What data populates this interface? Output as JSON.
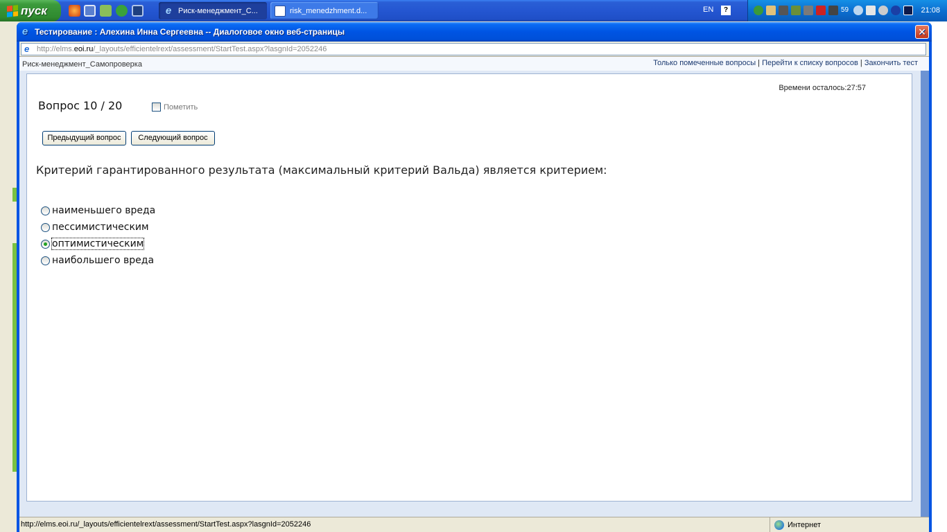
{
  "taskbar": {
    "start_label": "пуск",
    "tasks": [
      {
        "label": "Риск-менеджмент_С...",
        "icon": "ie-icon",
        "active": true
      },
      {
        "label": "risk_menedzhment.d...",
        "icon": "word-icon",
        "active": false
      }
    ],
    "lang": "EN",
    "tray_number": "59",
    "clock": "21:08"
  },
  "dialog": {
    "title": "Тестирование : Алехина Инна Сергеевна -- Диалоговое окно веб-страницы",
    "address_prefix": "http://elms.",
    "address_host": "eoi.ru",
    "address_rest": "/_layouts/efficientelrext/assessment/StartTest.aspx?lasgnId=2052246"
  },
  "page": {
    "course_name": "Риск-менеджмент_Самопроверка",
    "links": {
      "marked": "Только помеченные вопросы",
      "list": "Перейти к списку вопросов",
      "finish": "Закончить тест",
      "separator": " | "
    },
    "timer": "Времени осталось:27:57",
    "question_number": "Вопрос 10 / 20",
    "mark_label": "Пометить",
    "prev_button": "Предыдущий вопрос",
    "next_button": "Следующий вопрос",
    "question_text": "Критерий гарантированного результата (максимальный критерий Вальда) является критерием:",
    "options": [
      {
        "label": "наименьшего вреда",
        "checked": false
      },
      {
        "label": "пессимистическим",
        "checked": false
      },
      {
        "label": "оптимистическим",
        "checked": true
      },
      {
        "label": "наибольшего вреда",
        "checked": false
      }
    ]
  },
  "statusbar": {
    "url": "http://elms.eoi.ru/_layouts/efficientelrext/assessment/StartTest.aspx?lasgnId=2052246",
    "zone": "Интернет"
  },
  "colors": {
    "titlebar": "#0054e3",
    "taskbar": "#245edb",
    "start_button": "#3c9a3c",
    "radio_selected": "#21a121"
  }
}
